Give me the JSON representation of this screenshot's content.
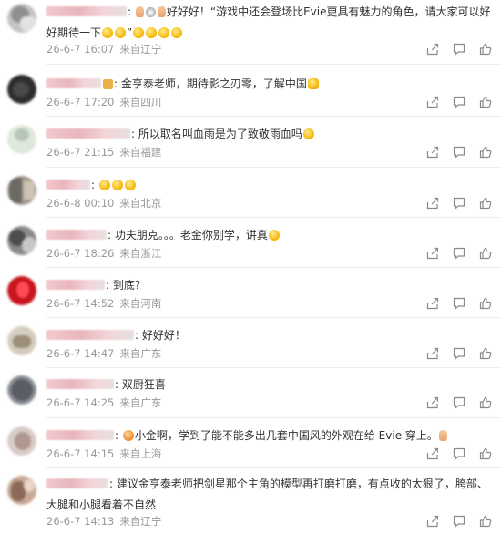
{
  "comments": [
    {
      "text": "好好好！“游戏中还会登场比Evie更具有魅力的角色，请大家可以好好期待一下",
      "pre": "hand-hand-face",
      "post_quote": "”",
      "time": "26-6-7 16:07",
      "location": "来自辽宁",
      "avatar": [
        "#9a9a9a",
        "#d8d8d8",
        "#b5b5b5"
      ]
    },
    {
      "text": "金亨泰老师，期待影之刃零，了解中国",
      "pre_colon": true,
      "time": "26-6-7 17:20",
      "location": "来自四川",
      "avatar": [
        "#2a2a2a",
        "#3d3d3d",
        "#555555"
      ]
    },
    {
      "text": "所以取名叫血雨是为了致敬雨血吗",
      "time": "26-6-7 21:15",
      "location": "来自福建",
      "avatar": [
        "#c7d6c8",
        "#e9efe6",
        "#a9b9aa"
      ]
    },
    {
      "text": "",
      "time": "26-6-8 00:10",
      "location": "来自北京",
      "avatar": [
        "#8f8a83",
        "#b9aea0",
        "#6d6a66"
      ]
    },
    {
      "text": "功夫朋克。。。老金你别学，讲真",
      "time": "26-6-7 18:26",
      "location": "来自浙江",
      "avatar": [
        "#555555",
        "#8a8a8a",
        "#c2c2c2"
      ]
    },
    {
      "text": "到底?",
      "time": "26-6-7 14:52",
      "location": "来自河南",
      "avatar": [
        "#b6141c",
        "#e2323a",
        "#7a0c10"
      ]
    },
    {
      "text": "好好好！",
      "time": "26-6-7 14:47",
      "location": "来自广东",
      "avatar": [
        "#c9c1b0",
        "#9b8f7a",
        "#e4ddd0"
      ]
    },
    {
      "text": "双厨狂喜",
      "time": "26-6-7 14:25",
      "location": "来自广东",
      "avatar": [
        "#7b7f86",
        "#a0a3a8",
        "#4f5359"
      ]
    },
    {
      "text": "小金啊，学到了能不能多出几套中国风的外观在给 Evie 穿上。",
      "time": "26-6-7 14:15",
      "location": "来自上海",
      "avatar": [
        "#d3c6c0",
        "#b49c93",
        "#e8e0dc"
      ]
    },
    {
      "text": "建议金亨泰老师把剑星那个主角的模型再打磨打磨，有点收的太狠了，胯部、大腿和小腿看着不自然",
      "time": "26-6-7 14:13",
      "location": "来自辽宁",
      "avatar": [
        "#b58f7c",
        "#dcc2b2",
        "#8c6a5a"
      ]
    }
  ],
  "icons": {
    "share": "share-icon",
    "comment": "comment-icon",
    "like": "thumb-up-icon"
  }
}
